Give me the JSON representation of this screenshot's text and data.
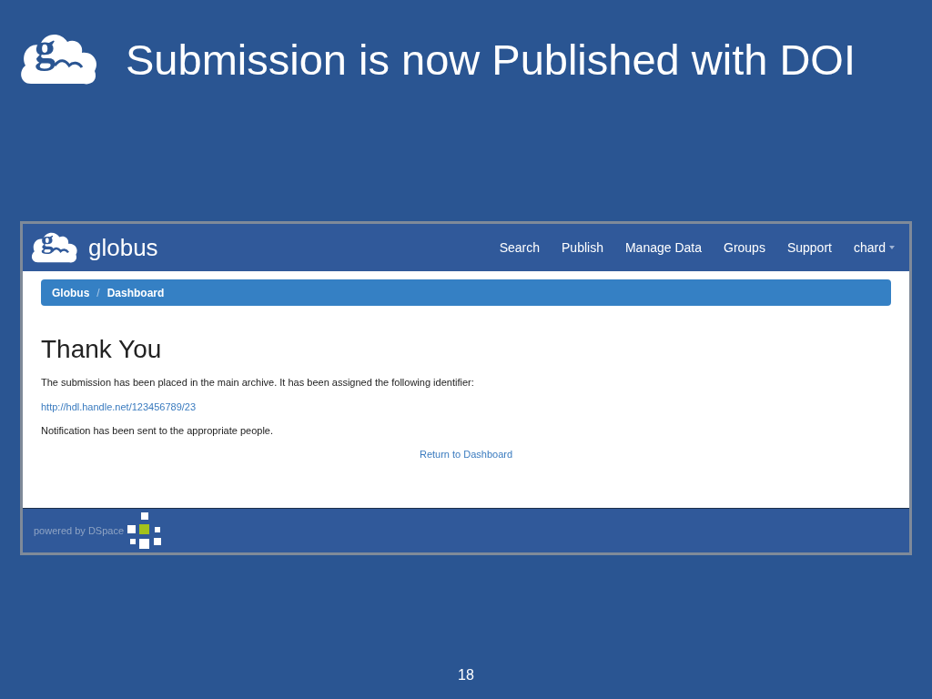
{
  "slide": {
    "logo_letter": "g",
    "title": "Submission is now Published with DOI",
    "page_number": "18"
  },
  "app": {
    "brand": {
      "logo_letter": "g",
      "name": "globus"
    },
    "nav": [
      {
        "label": "Search",
        "kind": "link"
      },
      {
        "label": "Publish",
        "kind": "link"
      },
      {
        "label": "Manage Data",
        "kind": "link"
      },
      {
        "label": "Groups",
        "kind": "link"
      },
      {
        "label": "Support",
        "kind": "link"
      },
      {
        "label": "chard",
        "kind": "dropdown"
      }
    ],
    "breadcrumb": [
      "Globus",
      "/",
      "Dashboard"
    ],
    "heading": "Thank You",
    "message": "The submission has been placed in the main archive. It has been assigned the following identifier:",
    "identifier_link": "http://hdl.handle.net/123456789/23",
    "notification": "Notification has been sent to the appropriate people.",
    "return_link": "Return to Dashboard",
    "footer": "powered by DSpace"
  }
}
